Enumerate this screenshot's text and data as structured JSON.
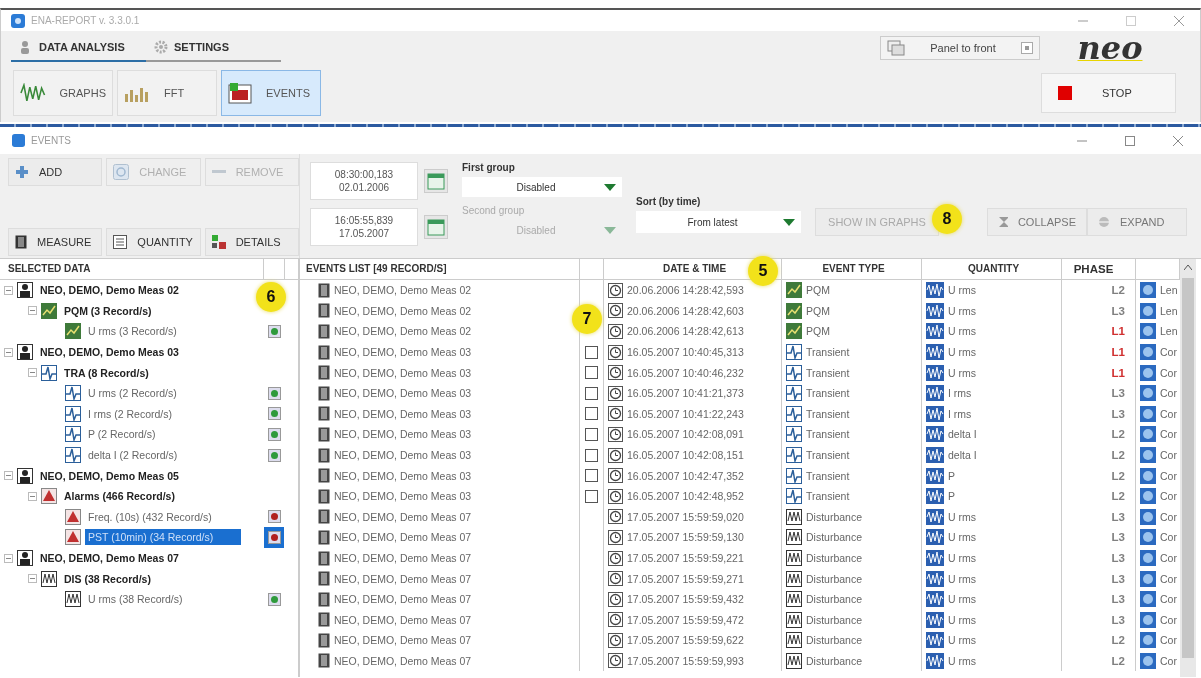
{
  "window": {
    "title": "ENA-REPORT v. 3.3.0.1"
  },
  "main_tabs": [
    {
      "label": "DATA ANALYSIS",
      "selected": true
    },
    {
      "label": "SETTINGS",
      "selected": false
    }
  ],
  "panel_to_front": {
    "label": "Panel to front"
  },
  "logo": {
    "text": "neo"
  },
  "ribbon": [
    {
      "label": "GRAPHS",
      "selected": false
    },
    {
      "label": "FFT",
      "selected": false
    },
    {
      "label": "EVENTS",
      "selected": true
    }
  ],
  "stop_button": {
    "label": "STOP"
  },
  "events_window": {
    "title": "EVENTS"
  },
  "actions": [
    {
      "label": "ADD",
      "disabled": false
    },
    {
      "label": "CHANGE",
      "disabled": true
    },
    {
      "label": "REMOVE",
      "disabled": true
    }
  ],
  "view_tabs": [
    {
      "label": "MEASURE"
    },
    {
      "label": "QUANTITY"
    },
    {
      "label": "DETAILS"
    }
  ],
  "date_from": {
    "time": "08:30:00,183",
    "date": "02.01.2006"
  },
  "date_to": {
    "time": "16:05:55,839",
    "date": "17.05.2007"
  },
  "first_group": {
    "label": "First group",
    "value": "Disabled",
    "disabled": false
  },
  "second_group": {
    "label": "Second group",
    "value": "Disabled",
    "disabled": true
  },
  "sort": {
    "label": "Sort (by time)",
    "value": "From latest"
  },
  "tool_buttons": [
    {
      "label": "SHOW IN GRAPHS",
      "disabled": true
    },
    {
      "label": "COLLAPSE",
      "disabled": false
    },
    {
      "label": "EXPAND",
      "disabled": false
    }
  ],
  "tree": {
    "header": "SELECTED DATA",
    "nodes": [
      {
        "label": "NEO, DEMO, Demo Meas 02",
        "kind": "measurement",
        "expanded": true,
        "selected": false,
        "children": [
          {
            "label": "PQM (3 Record/s)",
            "kind": "pqm",
            "expanded": true,
            "selected": false,
            "children": [
              {
                "label": "U rms (3 Record/s)",
                "kind": "pqm",
                "selected": false,
                "color": "#2e9a3c"
              }
            ]
          }
        ]
      },
      {
        "label": "NEO, DEMO, Demo Meas 03",
        "kind": "measurement",
        "expanded": true,
        "selected": false,
        "children": [
          {
            "label": "TRA (8 Record/s)",
            "kind": "transient",
            "expanded": true,
            "selected": false,
            "children": [
              {
                "label": "U rms (2 Record/s)",
                "kind": "transient",
                "selected": false,
                "color": "#2e9a3c"
              },
              {
                "label": "I rms (2 Record/s)",
                "kind": "transient",
                "selected": false,
                "color": "#2e9a3c"
              },
              {
                "label": "P (2 Record/s)",
                "kind": "transient",
                "selected": false,
                "color": "#2e9a3c"
              },
              {
                "label": "delta I (2 Record/s)",
                "kind": "transient",
                "selected": false,
                "color": "#2e9a3c"
              }
            ]
          }
        ]
      },
      {
        "label": "NEO, DEMO, Demo Meas 05",
        "kind": "measurement",
        "expanded": true,
        "selected": false,
        "children": [
          {
            "label": "Alarms (466 Record/s)",
            "kind": "alarm",
            "expanded": true,
            "selected": false,
            "children": [
              {
                "label": "Freq. (10s) (432 Record/s)",
                "kind": "alarm",
                "selected": false,
                "color": "#b02020"
              },
              {
                "label": "PST (10min) (34 Record/s)",
                "kind": "alarm",
                "selected": true,
                "color": "#b02020"
              }
            ]
          }
        ]
      },
      {
        "label": "NEO, DEMO, Demo Meas 07",
        "kind": "measurement",
        "expanded": true,
        "selected": false,
        "children": [
          {
            "label": "DIS (38 Record/s)",
            "kind": "disturbance",
            "expanded": true,
            "selected": false,
            "children": [
              {
                "label": "U rms (38 Record/s)",
                "kind": "disturbance",
                "selected": false,
                "color": "#2e9a3c"
              }
            ]
          }
        ]
      }
    ]
  },
  "events": {
    "columns": [
      "EVENTS LIST [49 RECORD/S]",
      "DATE & TIME",
      "EVENT TYPE",
      "QUANTITY",
      "PHASE"
    ],
    "rows": [
      {
        "source": "NEO, DEMO, Demo Meas 02",
        "datetime": "20.06.2006 14:28:42,593",
        "kind": "pqm",
        "type": "PQM",
        "quantity": "U rms",
        "phase": "L2",
        "color": "#808080",
        "column_6": "Len"
      },
      {
        "source": "NEO, DEMO, Demo Meas 02",
        "datetime": "20.06.2006 14:28:42,603",
        "kind": "pqm",
        "type": "PQM",
        "quantity": "U rms",
        "phase": "L3",
        "color": "#808080",
        "column_6": "Len"
      },
      {
        "source": "NEO, DEMO, Demo Meas 02",
        "datetime": "20.06.2006 14:28:42,613",
        "kind": "pqm",
        "type": "PQM",
        "quantity": "U rms",
        "phase": "L1",
        "color": "#d03030",
        "column_6": "Len"
      },
      {
        "source": "NEO, DEMO, Demo Meas 03",
        "checked": false,
        "datetime": "16.05.2007 10:40:45,313",
        "kind": "transient",
        "type": "Transient",
        "quantity": "U rms",
        "phase": "L1",
        "color": "#d03030",
        "column_6": "Cor"
      },
      {
        "source": "NEO, DEMO, Demo Meas 03",
        "checked": false,
        "datetime": "16.05.2007 10:40:46,232",
        "kind": "transient",
        "type": "Transient",
        "quantity": "U rms",
        "phase": "L1",
        "color": "#d03030",
        "column_6": "Cor"
      },
      {
        "source": "NEO, DEMO, Demo Meas 03",
        "checked": false,
        "datetime": "16.05.2007 10:41:21,373",
        "kind": "transient",
        "type": "Transient",
        "quantity": "I rms",
        "phase": "L3",
        "color": "#808080",
        "column_6": "Cor"
      },
      {
        "source": "NEO, DEMO, Demo Meas 03",
        "checked": false,
        "datetime": "16.05.2007 10:41:22,243",
        "kind": "transient",
        "type": "Transient",
        "quantity": "I rms",
        "phase": "L3",
        "color": "#808080",
        "column_6": "Cor"
      },
      {
        "source": "NEO, DEMO, Demo Meas 03",
        "checked": false,
        "datetime": "16.05.2007 10:42:08,091",
        "kind": "transient",
        "type": "Transient",
        "quantity": "delta I",
        "phase": "L2",
        "color": "#808080",
        "column_6": "Cor"
      },
      {
        "source": "NEO, DEMO, Demo Meas 03",
        "checked": false,
        "datetime": "16.05.2007 10:42:08,151",
        "kind": "transient",
        "type": "Transient",
        "quantity": "delta I",
        "phase": "L2",
        "color": "#808080",
        "column_6": "Cor"
      },
      {
        "source": "NEO, DEMO, Demo Meas 03",
        "checked": false,
        "datetime": "16.05.2007 10:42:47,352",
        "kind": "transient",
        "type": "Transient",
        "quantity": "P",
        "phase": "L2",
        "color": "#808080",
        "column_6": "Cor"
      },
      {
        "source": "NEO, DEMO, Demo Meas 03",
        "checked": false,
        "datetime": "16.05.2007 10:42:48,952",
        "kind": "transient",
        "type": "Transient",
        "quantity": "P",
        "phase": "L2",
        "color": "#808080",
        "column_6": "Cor"
      },
      {
        "source": "NEO, DEMO, Demo Meas 07",
        "datetime": "17.05.2007 15:59:59,020",
        "kind": "disturbance",
        "type": "Disturbance",
        "quantity": "U rms",
        "phase": "L3",
        "color": "#808080",
        "column_6": "Cor"
      },
      {
        "source": "NEO, DEMO, Demo Meas 07",
        "datetime": "17.05.2007 15:59:59,130",
        "kind": "disturbance",
        "type": "Disturbance",
        "quantity": "U rms",
        "phase": "L3",
        "color": "#808080",
        "column_6": "Cor"
      },
      {
        "source": "NEO, DEMO, Demo Meas 07",
        "datetime": "17.05.2007 15:59:59,221",
        "kind": "disturbance",
        "type": "Disturbance",
        "quantity": "U rms",
        "phase": "L3",
        "color": "#808080",
        "column_6": "Cor"
      },
      {
        "source": "NEO, DEMO, Demo Meas 07",
        "datetime": "17.05.2007 15:59:59,271",
        "kind": "disturbance",
        "type": "Disturbance",
        "quantity": "U rms",
        "phase": "L3",
        "color": "#808080",
        "column_6": "Cor"
      },
      {
        "source": "NEO, DEMO, Demo Meas 07",
        "datetime": "17.05.2007 15:59:59,432",
        "kind": "disturbance",
        "type": "Disturbance",
        "quantity": "U rms",
        "phase": "L3",
        "color": "#808080",
        "column_6": "Cor"
      },
      {
        "source": "NEO, DEMO, Demo Meas 07",
        "datetime": "17.05.2007 15:59:59,472",
        "kind": "disturbance",
        "type": "Disturbance",
        "quantity": "U rms",
        "phase": "L3",
        "color": "#808080",
        "column_6": "Cor"
      },
      {
        "source": "NEO, DEMO, Demo Meas 07",
        "datetime": "17.05.2007 15:59:59,622",
        "kind": "disturbance",
        "type": "Disturbance",
        "quantity": "U rms",
        "phase": "L2",
        "color": "#808080",
        "column_6": "Cor"
      },
      {
        "source": "NEO, DEMO, Demo Meas 07",
        "datetime": "17.05.2007 15:59:59,993",
        "kind": "disturbance",
        "type": "Disturbance",
        "quantity": "U rms",
        "phase": "L2",
        "color": "#808080",
        "column_6": "Cor"
      }
    ]
  },
  "callouts": [
    {
      "label": "5"
    },
    {
      "label": "6"
    },
    {
      "label": "7"
    },
    {
      "label": "8"
    }
  ]
}
